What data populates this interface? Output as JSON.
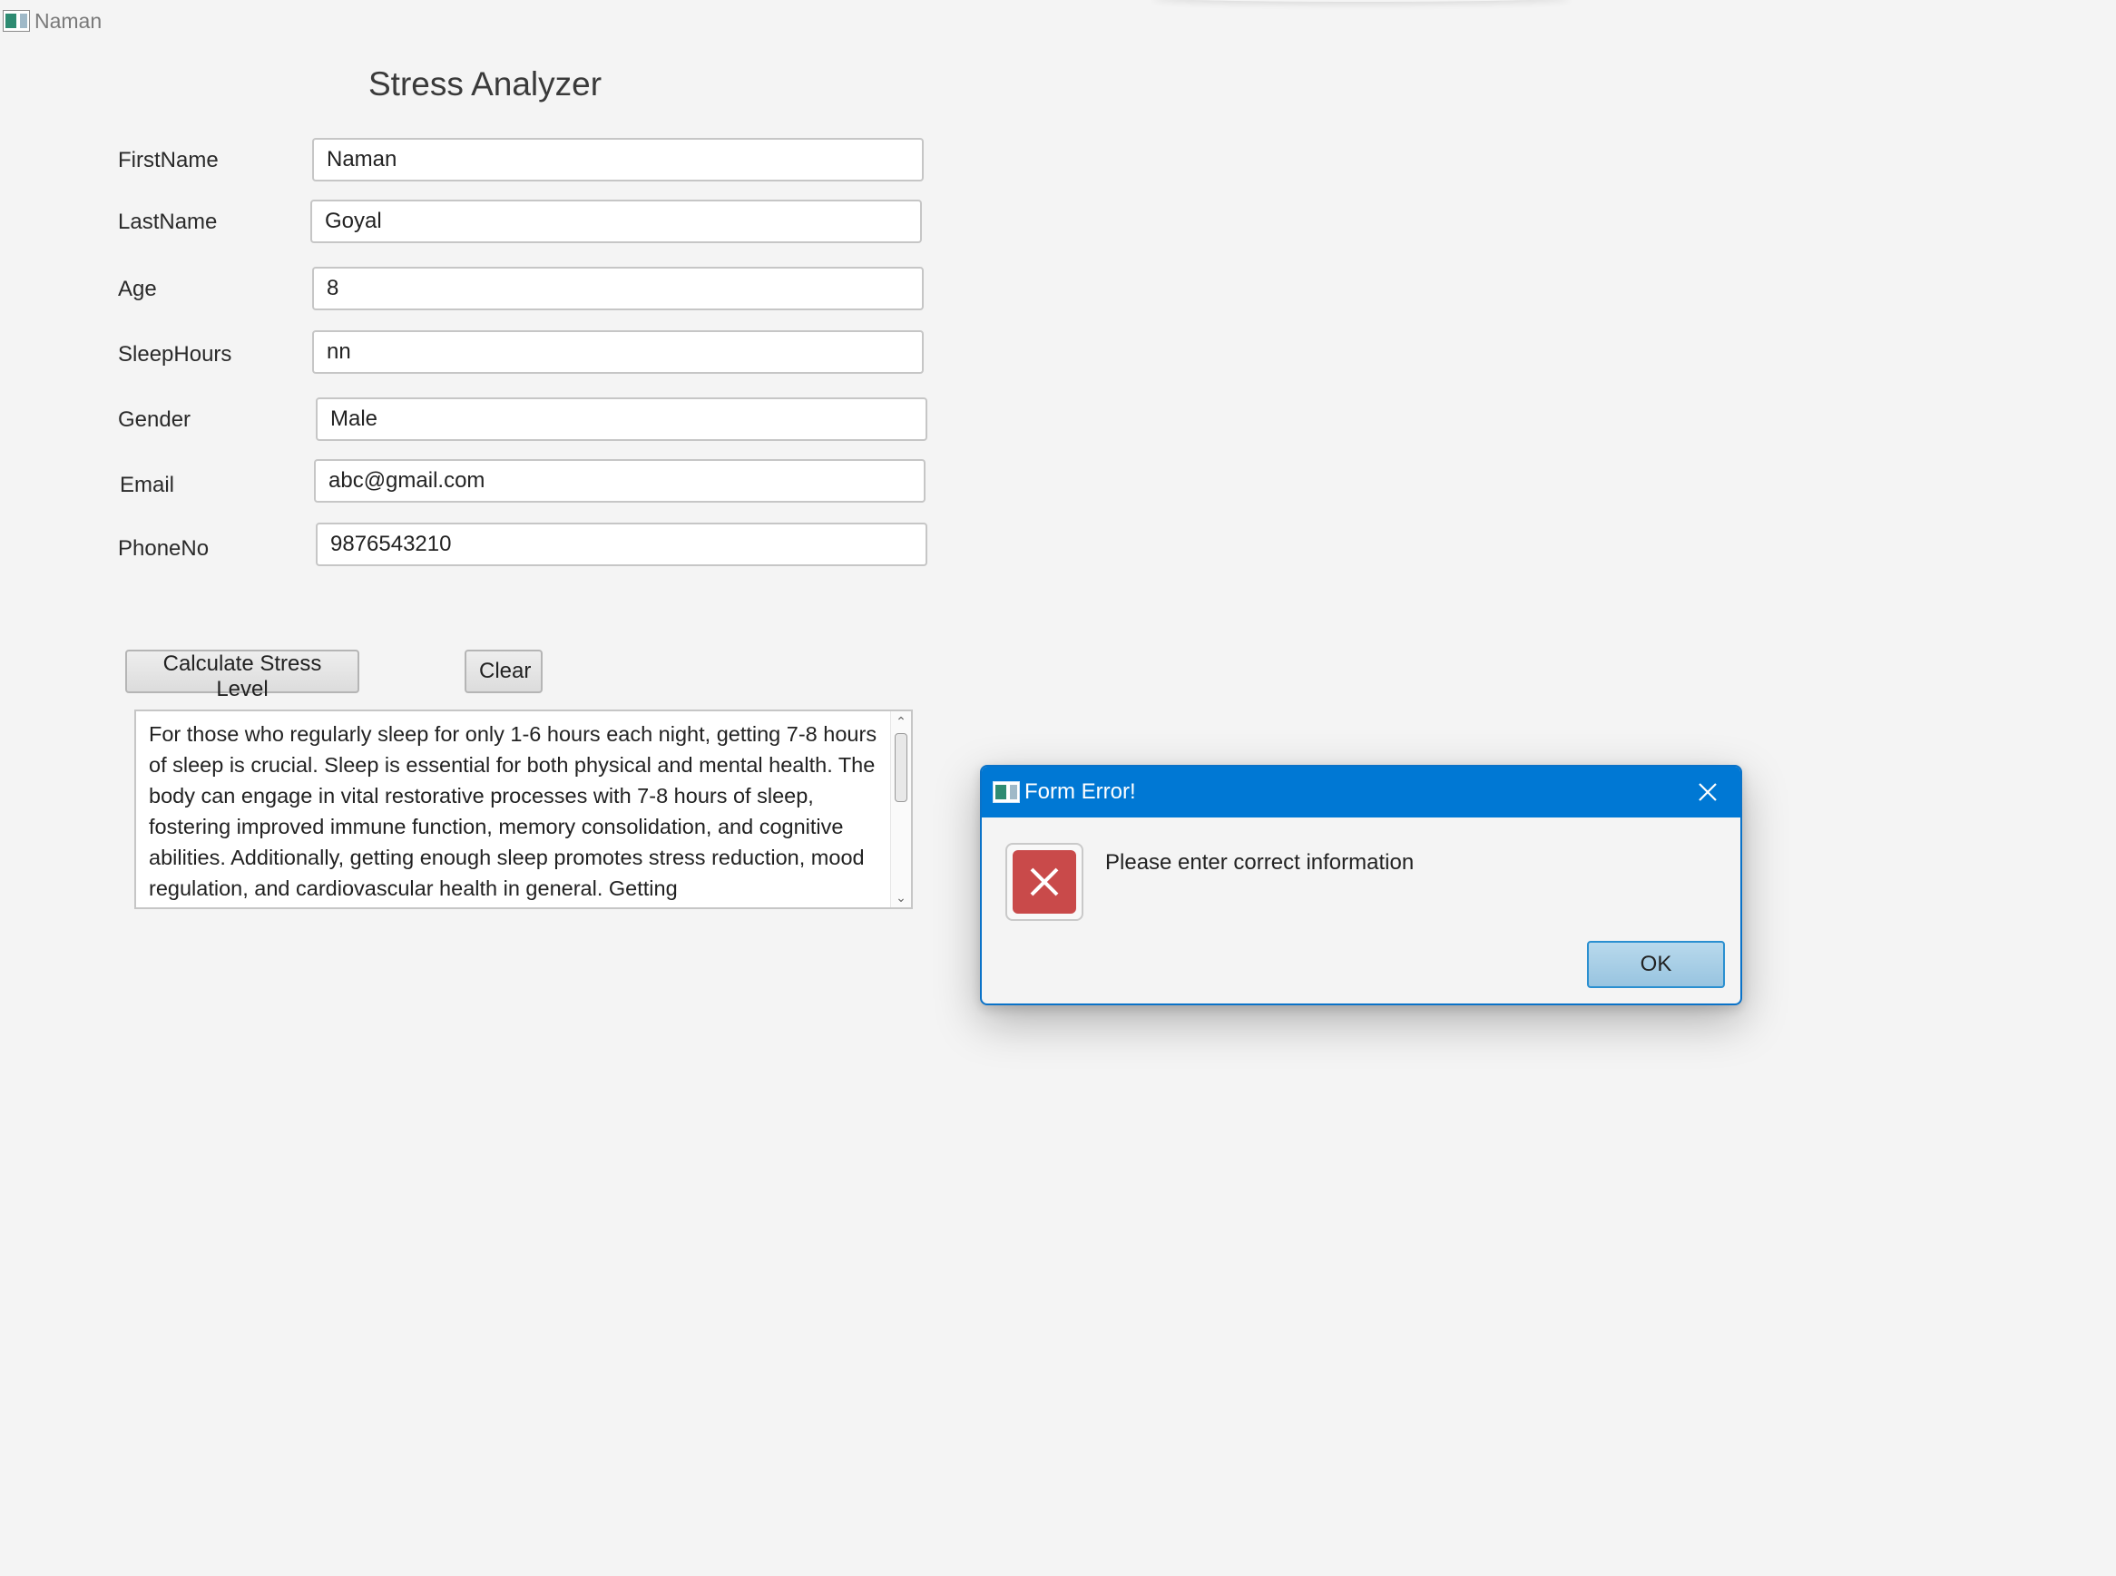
{
  "window": {
    "title": "Naman"
  },
  "app": {
    "heading": "Stress Analyzer"
  },
  "form": {
    "first_name": {
      "label": "FirstName",
      "value": "Naman"
    },
    "last_name": {
      "label": "LastName",
      "value": "Goyal"
    },
    "age": {
      "label": "Age",
      "value": "8"
    },
    "sleep_hours": {
      "label": "SleepHours",
      "value": "nn"
    },
    "gender": {
      "label": "Gender",
      "value": "Male"
    },
    "email": {
      "label": "Email",
      "value": "abc@gmail.com"
    },
    "phone": {
      "label": "PhoneNo",
      "value": "9876543210"
    }
  },
  "buttons": {
    "calculate": "Calculate Stress Level",
    "clear": "Clear"
  },
  "result": {
    "text": "For those who regularly sleep for only 1-6 hours each night, getting 7-8 hours of sleep is crucial. Sleep is essential for both physical and mental health. The body can engage in vital restorative processes with 7-8 hours of sleep, fostering improved immune function, memory consolidation, and cognitive abilities. Additionally, getting enough sleep promotes stress reduction, mood regulation, and cardiovascular health in general. Getting"
  },
  "dialog": {
    "title": "Form Error!",
    "message": "Please enter correct information",
    "ok_label": "OK",
    "icon": "error-x-icon",
    "accent_color": "#0078d4",
    "error_color": "#c94a4a"
  }
}
